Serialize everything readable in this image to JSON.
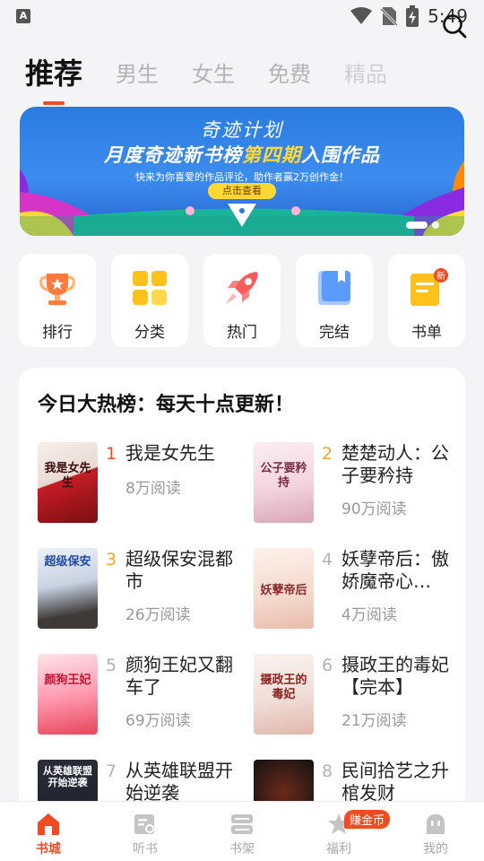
{
  "status_bar": {
    "time": "5:49",
    "app_icon": "A"
  },
  "tabs": [
    {
      "label": "推荐",
      "active": true
    },
    {
      "label": "男生",
      "active": false
    },
    {
      "label": "女生",
      "active": false
    },
    {
      "label": "免费",
      "active": false
    },
    {
      "label": "精品",
      "active": false
    }
  ],
  "banner": {
    "title_small": "奇迹计划",
    "title_pre": "月度奇迹新书榜",
    "title_highlight": "第四期",
    "title_post": "入围作品",
    "subtitle": "快来为你喜爱的作品评论，助作者赢2万创作金！",
    "button": "点击查看"
  },
  "quick_entries": [
    {
      "label": "排行",
      "icon": "trophy-icon"
    },
    {
      "label": "分类",
      "icon": "category-grid-icon"
    },
    {
      "label": "热门",
      "icon": "rocket-icon"
    },
    {
      "label": "完结",
      "icon": "finished-book-icon"
    },
    {
      "label": "书单",
      "icon": "booklist-icon",
      "badge": "新"
    }
  ],
  "ranking": {
    "title": "今日大热榜：每天十点更新！",
    "books": [
      {
        "rank": "1",
        "title": "我是女先生",
        "reads": "8万阅读",
        "cover_text": "我是女先生"
      },
      {
        "rank": "2",
        "title": "楚楚动人：公子要矜持",
        "reads": "90万阅读",
        "cover_text": "公子要矜持"
      },
      {
        "rank": "3",
        "title": "超级保安混都市",
        "reads": "26万阅读",
        "cover_text": "超级保安"
      },
      {
        "rank": "4",
        "title": "妖孽帝后：傲娇魔帝心…",
        "reads": "4万阅读",
        "cover_text": "妖孽帝后"
      },
      {
        "rank": "5",
        "title": "颜狗王妃又翻车了",
        "reads": "69万阅读",
        "cover_text": "颜狗王妃"
      },
      {
        "rank": "6",
        "title": "摄政王的毒妃【完本】",
        "reads": "21万阅读",
        "cover_text": "摄政王的毒妃"
      },
      {
        "rank": "7",
        "title": "从英雄联盟开始逆袭",
        "reads": "",
        "cover_text": "从英雄联盟开始逆袭"
      },
      {
        "rank": "8",
        "title": "民间拾艺之升棺发财",
        "reads": "",
        "cover_text": ""
      }
    ]
  },
  "bottom_nav": [
    {
      "label": "书城",
      "active": true
    },
    {
      "label": "听书",
      "active": false
    },
    {
      "label": "书架",
      "active": false
    },
    {
      "label": "福利",
      "active": false,
      "badge": "赚金币"
    },
    {
      "label": "我的",
      "active": false
    }
  ],
  "colors": {
    "accent": "#f14b23",
    "rank_top": "#f14b23",
    "rank_mid": "#f5a524",
    "rank_rest": "#b3b3b3"
  }
}
